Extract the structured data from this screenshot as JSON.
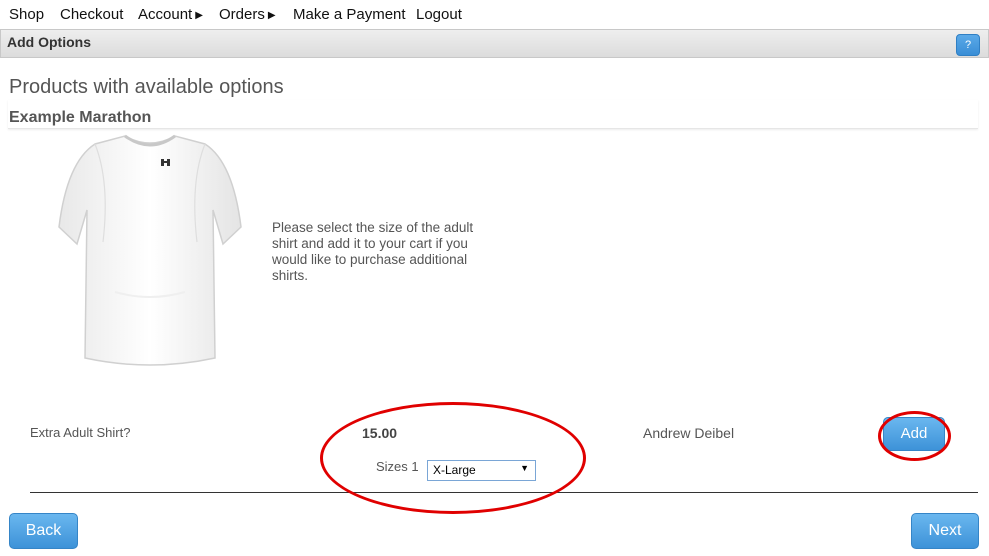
{
  "nav": {
    "shop": "Shop",
    "checkout": "Checkout",
    "account": "Account",
    "orders": "Orders",
    "make_payment": "Make a Payment",
    "logout": "Logout"
  },
  "titlebar": {
    "title": "Add Options",
    "help": "?"
  },
  "section_title": "Products with available options",
  "product": {
    "name": "Example Marathon",
    "description": "Please select the size of the adult shirt and add it to your cart if you would like to purchase additional shirts."
  },
  "option_row": {
    "label": "Extra Adult Shirt?",
    "price": "15.00",
    "attendee": "Andrew Deibel",
    "add_label": "Add",
    "sizes_label": "Sizes 1",
    "size_selected": "X-Large"
  },
  "footer": {
    "back_label": "Back",
    "next_label": "Next"
  },
  "colors": {
    "accent_button": "#4a9fe0",
    "annotation_red": "#e00000"
  },
  "icons": {
    "caret": "triangle-right-icon",
    "select_arrow": "triangle-down-icon",
    "product": "tshirt-icon"
  }
}
